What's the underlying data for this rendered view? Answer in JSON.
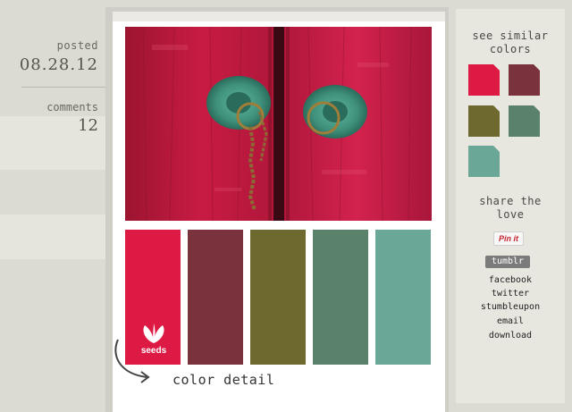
{
  "meta": {
    "posted_label": "posted",
    "posted_date": "08.28.12",
    "comments_label": "comments",
    "comments_count": "12"
  },
  "palette": {
    "swatches": [
      {
        "color": "#dc1a44"
      },
      {
        "color": "#7a333c"
      },
      {
        "color": "#6e6a2f"
      },
      {
        "color": "#5a826b"
      },
      {
        "color": "#6aa796"
      }
    ],
    "logo_text": "seeds",
    "color_detail_label": "color detail"
  },
  "sidebar": {
    "similar_title_line1": "see similar",
    "similar_title_line2": "colors",
    "similar_colors": [
      "#dc1a44",
      "#7a333c",
      "#6e6a2f",
      "#5a826b",
      "#6aa796"
    ],
    "share_title_line1": "share the",
    "share_title_line2": "love",
    "pinit_label": "Pin it",
    "tumblr_label": "tumblr",
    "links": [
      "facebook",
      "twitter",
      "stumbleupon",
      "email",
      "download"
    ]
  }
}
